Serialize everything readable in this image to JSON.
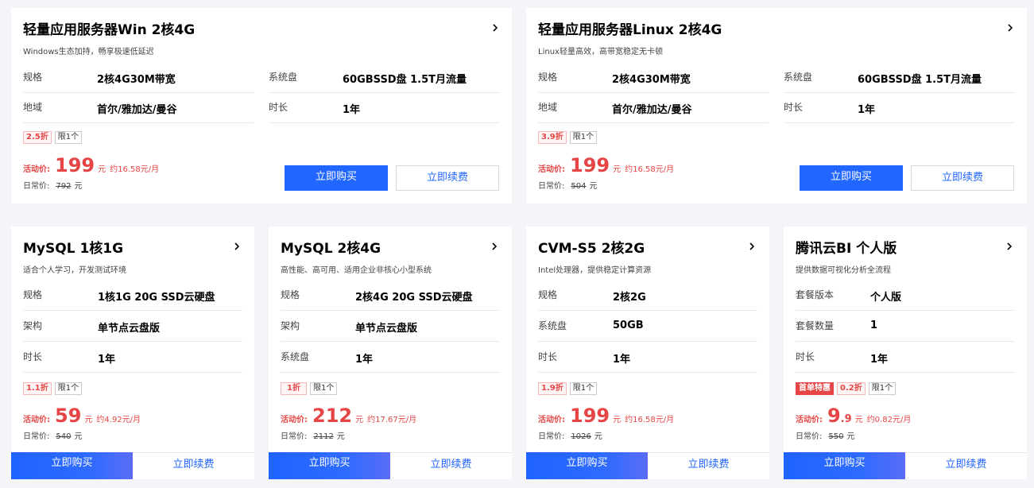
{
  "cards": [
    {
      "title": "轻量应用服务器Win 2核4G",
      "subtitle": "Windows生态加持，畅享极速低延迟",
      "specs": [
        {
          "label": "规格",
          "value": "2核4G30M带宽"
        },
        {
          "label": "系统盘",
          "value": "60GBSSD盘 1.5T月流量"
        },
        {
          "label": "地域",
          "value": "首尔/雅加达/曼谷"
        },
        {
          "label": "时长",
          "value": "1年"
        }
      ],
      "tags": [
        "2.5折",
        "限1个"
      ],
      "price_label": "活动价:",
      "price": "199",
      "price_unit": "元",
      "monthly": "约16.58元/月",
      "orig_label": "日常价:",
      "orig_price": "792",
      "orig_unit": "元",
      "buy_label": "立即购买",
      "renew_label": "立即续费"
    },
    {
      "title": "轻量应用服务器Linux 2核4G",
      "subtitle": "Linux轻量高效，高带宽稳定无卡顿",
      "specs": [
        {
          "label": "规格",
          "value": "2核4G30M带宽"
        },
        {
          "label": "系统盘",
          "value": "60GBSSD盘 1.5T月流量"
        },
        {
          "label": "地域",
          "value": "首尔/雅加达/曼谷"
        },
        {
          "label": "时长",
          "value": "1年"
        }
      ],
      "tags": [
        "3.9折",
        "限1个"
      ],
      "price_label": "活动价:",
      "price": "199",
      "price_unit": "元",
      "monthly": "约16.58元/月",
      "orig_label": "日常价:",
      "orig_price": "504",
      "orig_unit": "元",
      "buy_label": "立即购买",
      "renew_label": "立即续费"
    },
    {
      "title": "MySQL 1核1G",
      "subtitle": "适合个人学习，开发测试环境",
      "specs": [
        {
          "label": "规格",
          "value": "1核1G 20G SSD云硬盘"
        },
        {
          "label": "架构",
          "value": "单节点云盘版"
        },
        {
          "label": "时长",
          "value": "1年"
        }
      ],
      "tags": [
        "1.1折",
        "限1个"
      ],
      "price_label": "活动价:",
      "price": "59",
      "price_unit": "元",
      "monthly": "约4.92元/月",
      "orig_label": "日常价:",
      "orig_price": "540",
      "orig_unit": "元",
      "buy_label": "立即购买",
      "renew_label": "立即续费"
    },
    {
      "title": "MySQL 2核4G",
      "subtitle": "高性能、高可用、适用企业非核心小型系统",
      "specs": [
        {
          "label": "规格",
          "value": "2核4G 20G SSD云硬盘"
        },
        {
          "label": "架构",
          "value": "单节点云盘版"
        },
        {
          "label": "系统盘",
          "value": "1年"
        }
      ],
      "tags": [
        "1折",
        "限1个"
      ],
      "price_label": "活动价:",
      "price": "212",
      "price_unit": "元",
      "monthly": "约17.67元/月",
      "orig_label": "日常价:",
      "orig_price": "2112",
      "orig_unit": "元",
      "buy_label": "立即购买",
      "renew_label": "立即续费"
    },
    {
      "title": "CVM-S5 2核2G",
      "subtitle": "Intel处理器，提供稳定计算资源",
      "specs": [
        {
          "label": "规格",
          "value": "2核2G"
        },
        {
          "label": "系统盘",
          "value": "50GB"
        },
        {
          "label": "时长",
          "value": "1年"
        }
      ],
      "tags": [
        "1.9折",
        "限1个"
      ],
      "price_label": "活动价:",
      "price": "199",
      "price_unit": "元",
      "monthly": "约16.58元/月",
      "orig_label": "日常价:",
      "orig_price": "1026",
      "orig_unit": "元",
      "buy_label": "立即购买",
      "renew_label": "立即续费"
    },
    {
      "title": "腾讯云BI 个人版",
      "subtitle": "提供数据可视化分析全流程",
      "specs": [
        {
          "label": "套餐版本",
          "value": "个人版"
        },
        {
          "label": "套餐数量",
          "value": "1"
        },
        {
          "label": "时长",
          "value": "1年"
        }
      ],
      "tags": [
        "首单特惠",
        "0.2折",
        "限1个"
      ],
      "price_label": "活动价:",
      "price": "9",
      "price_frac": ".9",
      "price_unit": "元",
      "monthly": "约0.82元/月",
      "orig_label": "日常价:",
      "orig_price": "550",
      "orig_unit": "元",
      "buy_label": "立即购买",
      "renew_label": "立即续费"
    }
  ],
  "icons": {
    "card_arrow": "chevron-right-icon"
  },
  "colors": {
    "accent": "#2166ff",
    "price": "#e54545",
    "background": "#f3f5f8"
  }
}
